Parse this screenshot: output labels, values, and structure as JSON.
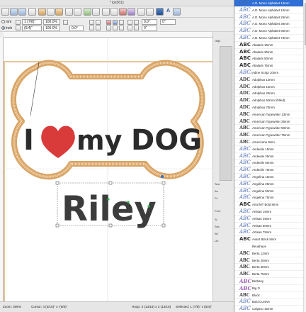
{
  "window": {
    "title": "* ips5611"
  },
  "toolbar2": {
    "unit_label_1": "mm",
    "unit_label_2": "inch",
    "width_value": "1 (7/8)\"",
    "width_pct": "100.0%",
    "height_value": "(5/4)\"",
    "height_pct": "100.0%",
    "rotation_value": "0.0°",
    "angle_value": "0.0\"",
    "skew_value": "0\"",
    "skew2_value": "0°"
  },
  "canvas": {
    "design_text_heart_line": "I ♥ MY DOG",
    "design_text_name": "Riley",
    "colors": {
      "bone_outline": "#d9a464",
      "bone_inner": "#f4dcc0",
      "heart": "#d93a3a",
      "text_dark": "#2b2b2b",
      "name_text": "#3c3c3c",
      "hoop": "#e7c79a",
      "selection": "#2f6fd6"
    }
  },
  "dock": {
    "tab_label": "Objs",
    "side_label_1": "Text",
    "side_label_2": "Au",
    "side_label_3": "Pr",
    "side_label_4": "Font",
    "side_label_5": "Si",
    "side_label_6": "Sec",
    "side_label_7": "Wi",
    "side_label_8": "Lin"
  },
  "status": {
    "zoom": "Zoom: 305%",
    "cursor": "Cursor: 4 (3/16)\" x -(5/8)\"",
    "hoop": "Hoop: 3 (13/16) x 3 (13/16)",
    "selected": "Selected: 1 (7/8)\" x (5/4)\""
  },
  "font_panel": {
    "fonts": [
      {
        "sample": "ABC",
        "name": "A.D. Mono Alphabet 13mm",
        "style": "script",
        "selected": true
      },
      {
        "sample": "ABC",
        "name": "A.D. Mono Alphabet 15mm",
        "style": "script"
      },
      {
        "sample": "ABC",
        "name": "A.D. Mono Alphabet 25mm",
        "style": "script"
      },
      {
        "sample": "ABC",
        "name": "A.D. Mono Alphabet 36mm",
        "style": "script"
      },
      {
        "sample": "ABC",
        "name": "A.D. Mono Alphabet 50mm",
        "style": "script"
      },
      {
        "sample": "ABC",
        "name": "A.D. Mono Alphabet 75mm",
        "style": "script"
      },
      {
        "sample": "ABC",
        "name": "Abalaris 15mm",
        "style": "block"
      },
      {
        "sample": "ABC",
        "name": "Abalaris 25mm",
        "style": "block"
      },
      {
        "sample": "ABC",
        "name": "Abalaris 50mm",
        "style": "block"
      },
      {
        "sample": "ABC",
        "name": "Abalaris 75mm",
        "style": "block"
      },
      {
        "sample": "ABCD",
        "name": "Adine Script 10mm",
        "style": "script"
      },
      {
        "sample": "ADC",
        "name": "Adolphus 10mm",
        "style": "bigs"
      },
      {
        "sample": "ADC",
        "name": "Adolphus 15mm",
        "style": "bigs"
      },
      {
        "sample": "ADC",
        "name": "Adolphus 25mm",
        "style": "bigs"
      },
      {
        "sample": "ADC",
        "name": "Adolphus 50mm (Filled)",
        "style": "bigs"
      },
      {
        "sample": "ADC",
        "name": "Adolphus 75mm",
        "style": "bigs"
      },
      {
        "sample": "ABC",
        "name": "American Typewriter 13mm",
        "style": "bigs"
      },
      {
        "sample": "ABC",
        "name": "American Typewriter 25mm",
        "style": "bigs"
      },
      {
        "sample": "ABC",
        "name": "American Typewriter 50mm",
        "style": "bigs"
      },
      {
        "sample": "ABC",
        "name": "American Typewriter 75mm",
        "style": "bigs"
      },
      {
        "sample": "ABC",
        "name": "Americana 8mm",
        "style": "bigs"
      },
      {
        "sample": "ABC",
        "name": "Andeeile 15mm",
        "style": "script"
      },
      {
        "sample": "ABC",
        "name": "Andeeile 25mm",
        "style": "script"
      },
      {
        "sample": "ABC",
        "name": "Andeeile 50mm",
        "style": "script"
      },
      {
        "sample": "ABC",
        "name": "Andeeile 75mm",
        "style": "script"
      },
      {
        "sample": "ABC",
        "name": "Angelina 15mm",
        "style": "script"
      },
      {
        "sample": "ABC",
        "name": "Angelina 25mm",
        "style": "script"
      },
      {
        "sample": "ABC",
        "name": "Angelina 50mm",
        "style": "script"
      },
      {
        "sample": "ABC",
        "name": "Angelina 75mm",
        "style": "script"
      },
      {
        "sample": "ABC",
        "name": "Arial MT Bold 8mm",
        "style": "block"
      },
      {
        "sample": "ABC",
        "name": "Artisan 15mm",
        "style": "script"
      },
      {
        "sample": "ABC",
        "name": "Artisan 25mm",
        "style": "script"
      },
      {
        "sample": "ABC",
        "name": "Artisan 50mm",
        "style": "script"
      },
      {
        "sample": "ABC",
        "name": "Artisan 75mm",
        "style": "script"
      },
      {
        "sample": "ABC",
        "name": "Avant Black 8mm",
        "style": "block"
      },
      {
        "sample": "",
        "name": "Beuahaus",
        "style": "block"
      },
      {
        "sample": "ABC",
        "name": "Berta 12mm",
        "style": "bigs"
      },
      {
        "sample": "ABC",
        "name": "Berta 25mm",
        "style": "bigs"
      },
      {
        "sample": "ABC",
        "name": "Berta 50mm",
        "style": "bigs"
      },
      {
        "sample": "ABC",
        "name": "Berta 75mm",
        "style": "bigs"
      },
      {
        "sample": "ABC",
        "name": "Bethany",
        "style": "color"
      },
      {
        "sample": "ABC",
        "name": "Big G",
        "style": "color"
      },
      {
        "sample": "ABC",
        "name": "Block",
        "style": "bigs"
      },
      {
        "sample": "ABC",
        "name": "Bold Cursive",
        "style": "script"
      },
      {
        "sample": "ABC",
        "name": "Calypso 15mm",
        "style": "script"
      }
    ]
  }
}
